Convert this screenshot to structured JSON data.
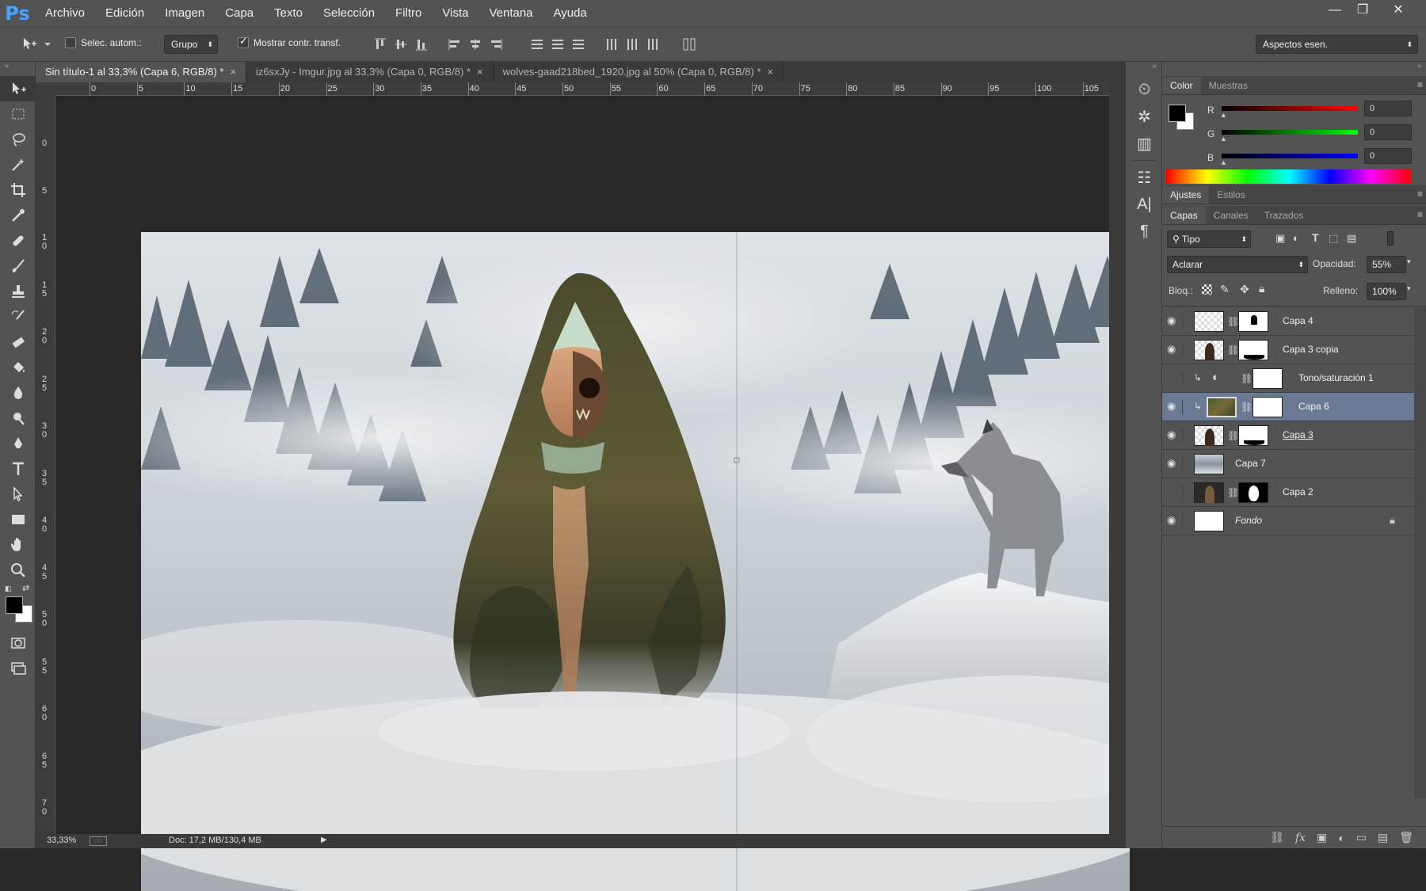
{
  "menubar": {
    "logo": "Ps",
    "items": [
      "Archivo",
      "Edición",
      "Imagen",
      "Capa",
      "Texto",
      "Selección",
      "Filtro",
      "Vista",
      "Ventana",
      "Ayuda"
    ],
    "window_controls": [
      "—",
      "❐",
      "✕"
    ]
  },
  "options": {
    "auto_select_label": "Selec. autom.:",
    "auto_select_value": "Grupo",
    "show_transform_label": "Mostrar contr. transf.",
    "workspace_value": "Aspectos esen."
  },
  "tabs": [
    {
      "label": "Sin título-1 al 33,3% (Capa 6, RGB/8) *",
      "active": true
    },
    {
      "label": "iz6sxJy - Imgur.jpg al 33,3% (Capa 0, RGB/8) *",
      "active": false
    },
    {
      "label": "wolves-gaad218bed_1920.jpg al 50% (Capa 0, RGB/8) *",
      "active": false
    }
  ],
  "ruler": {
    "top": [
      "0",
      "5",
      "10",
      "15",
      "20",
      "25",
      "30",
      "35",
      "40",
      "45",
      "50",
      "55",
      "60",
      "65",
      "70",
      "75",
      "80",
      "85",
      "90",
      "95",
      "100",
      "105"
    ],
    "left": [
      "0",
      "5",
      "1\n0",
      "1\n5",
      "2\n0",
      "2\n5",
      "3\n0",
      "3\n5",
      "4\n0",
      "4\n5",
      "5\n0",
      "5\n5",
      "6\n0",
      "6\n5",
      "7\n0"
    ]
  },
  "status": {
    "zoom": "33,33%",
    "doc": "Doc: 17,2 MB/130,4 MB"
  },
  "color_panel": {
    "tabs": [
      "Color",
      "Muestras"
    ],
    "r_label": "R",
    "g_label": "G",
    "b_label": "B",
    "r": "0",
    "g": "0",
    "b": "0"
  },
  "adjust_panel": {
    "tabs": [
      "Ajustes",
      "Estilos"
    ]
  },
  "layers_panel": {
    "tabs": [
      "Capas",
      "Canales",
      "Trazados"
    ],
    "filter_kind": "Tipo",
    "blend_mode": "Aclarar",
    "opacity_label": "Opacidad:",
    "opacity": "55%",
    "lock_label": "Bloq.:",
    "fill_label": "Relleno:",
    "fill": "100%",
    "layers": [
      {
        "name": "Capa 4",
        "visible": true,
        "selected": false
      },
      {
        "name": "Capa 3 copia",
        "visible": true,
        "selected": false
      },
      {
        "name": "Tono/saturación 1",
        "visible": false,
        "selected": false
      },
      {
        "name": "Capa 6",
        "visible": true,
        "selected": true
      },
      {
        "name": "Capa 3",
        "visible": true,
        "selected": false
      },
      {
        "name": "Capa 7",
        "visible": true,
        "selected": false
      },
      {
        "name": "Capa 2",
        "visible": false,
        "selected": false
      },
      {
        "name": "Fondo",
        "visible": true,
        "selected": false
      }
    ]
  },
  "colors": {
    "ui_bg": "#535353",
    "dark_bg": "#282828",
    "selected_layer": "#6a7a95",
    "accent_blue": "#4aa3ff"
  }
}
